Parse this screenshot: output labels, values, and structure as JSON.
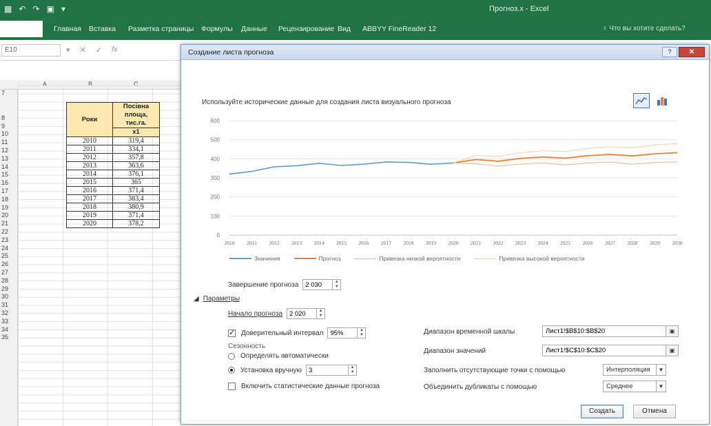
{
  "excel": {
    "quick_access": [
      "▦",
      "↶",
      "↷",
      "▣",
      "▾"
    ],
    "window_title": "Прогноз.x - Excel",
    "tabs": [
      "Главная",
      "Вставка",
      "Разметка страницы",
      "Формулы",
      "Данные",
      "Рецензирование",
      "Вид",
      "ABBYY FineReader 12"
    ],
    "tell_me": "Что вы хотите сделать?",
    "name_box": "E10",
    "fx_label": "fx",
    "columns": [
      "A",
      "B",
      "C"
    ],
    "rows": [
      "7",
      "8",
      "9",
      "10",
      "11",
      "12",
      "13",
      "14",
      "15",
      "16",
      "17",
      "18",
      "19",
      "20",
      "21",
      "22",
      "23",
      "24",
      "25",
      "26",
      "27",
      "28",
      "29",
      "30",
      "31",
      "32",
      "33",
      "34",
      "35"
    ]
  },
  "table": {
    "header_years": "Роки",
    "header_area_l1": "Посівна",
    "header_area_l2": "площа,",
    "header_area_l3": "тис.га.",
    "header_x1": "x1",
    "rows": [
      {
        "year": "2010",
        "value": "319,4"
      },
      {
        "year": "2011",
        "value": "334,1"
      },
      {
        "year": "2012",
        "value": "357,8"
      },
      {
        "year": "2013",
        "value": "363,6"
      },
      {
        "year": "2014",
        "value": "376,1"
      },
      {
        "year": "2015",
        "value": "365"
      },
      {
        "year": "2016",
        "value": "371,4"
      },
      {
        "year": "2017",
        "value": "383,4"
      },
      {
        "year": "2018",
        "value": "380,9"
      },
      {
        "year": "2019",
        "value": "371,4"
      },
      {
        "year": "2020",
        "value": "378,2"
      }
    ]
  },
  "dialog": {
    "title": "Создание листа прогноза",
    "help": "?",
    "close": "✕",
    "description": "Используйте исторические данные для создания листа визуального прогноза",
    "forecast_end_label": "Завершение прогноза",
    "forecast_end_value": "2 030",
    "params_label": "Параметры",
    "forecast_start_label": "Начало прогноза",
    "forecast_start_value": "2 020",
    "confidence_label": "Доверительный интервал",
    "confidence_value": "95%",
    "seasonality_label": "Сезонность",
    "season_auto_label": "Определять автоматически",
    "season_manual_label": "Установка вручную",
    "season_manual_value": "3",
    "include_stats_label": "Включить статистические данные прогноза",
    "timeline_range_label": "Диапазон временной шкалы",
    "timeline_range_value": "Лист1!$B$10:$B$20",
    "values_range_label": "Диапазон значений",
    "values_range_value": "Лист1!$C$10:$C$20",
    "fill_missing_label": "Заполнить отсутствующие точки с помощью",
    "fill_missing_value": "Интерполяция",
    "aggregate_label": "Объединить дубликаты с помощью",
    "aggregate_value": "Среднее",
    "create_button": "Создать",
    "cancel_button": "Отмена"
  },
  "chart_data": {
    "type": "line",
    "x": [
      2010,
      2011,
      2012,
      2013,
      2014,
      2015,
      2016,
      2017,
      2018,
      2019,
      2020,
      2021,
      2022,
      2023,
      2024,
      2025,
      2026,
      2027,
      2028,
      2029,
      2030
    ],
    "ylim": [
      0,
      600
    ],
    "yticks": [
      0,
      100,
      200,
      300,
      400,
      500,
      600
    ],
    "grid": true,
    "legend_position": "bottom",
    "series": [
      {
        "name": "Значения",
        "color": "#5b9bd5",
        "values": [
          319.4,
          334.1,
          357.8,
          363.6,
          376.1,
          365,
          371.4,
          383.4,
          380.9,
          371.4,
          378.2,
          null,
          null,
          null,
          null,
          null,
          null,
          null,
          null,
          null,
          null
        ]
      },
      {
        "name": "Прогноз",
        "color": "#ed7d31",
        "values": [
          null,
          null,
          null,
          null,
          null,
          null,
          null,
          null,
          null,
          null,
          378.2,
          396,
          387,
          402,
          410,
          403,
          416,
          423,
          415,
          426,
          432
        ]
      },
      {
        "name": "Привязка низкой вероятности",
        "color": "#f4b183",
        "values": [
          null,
          null,
          null,
          null,
          null,
          null,
          null,
          null,
          null,
          null,
          378.2,
          374,
          362,
          372,
          378,
          368,
          378,
          383,
          372,
          380,
          384
        ]
      },
      {
        "name": "Привязка высокой вероятности",
        "color": "#f8cbad",
        "values": [
          null,
          null,
          null,
          null,
          null,
          null,
          null,
          null,
          null,
          null,
          378.2,
          418,
          412,
          432,
          442,
          438,
          454,
          463,
          458,
          472,
          480
        ]
      }
    ]
  }
}
